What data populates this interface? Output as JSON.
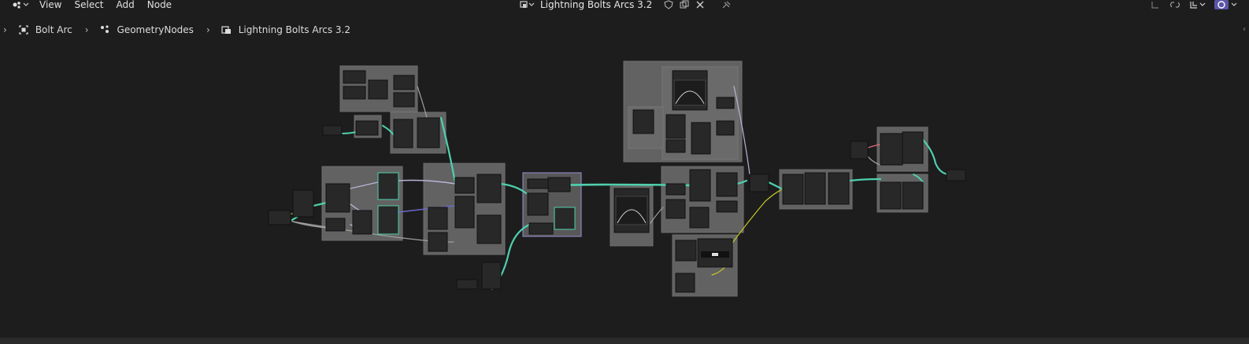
{
  "menu": {
    "view": "View",
    "select": "Select",
    "add": "Add",
    "node": "Node"
  },
  "header": {
    "tree_name": "Lightning Bolts Arcs 3.2"
  },
  "breadcrumb": {
    "object": "Bolt Arc",
    "modifier": "GeometryNodes",
    "tree": "Lightning Bolts Arcs 3.2"
  },
  "colors": {
    "background": "#1d1d1d",
    "frame": "#626262",
    "geometry_link": "#4fd0ad",
    "float_link": "#a0a0a0",
    "vector_link": "#6a6acb",
    "color_link": "#c6c629",
    "selected_frame": "#9b8fd6"
  }
}
